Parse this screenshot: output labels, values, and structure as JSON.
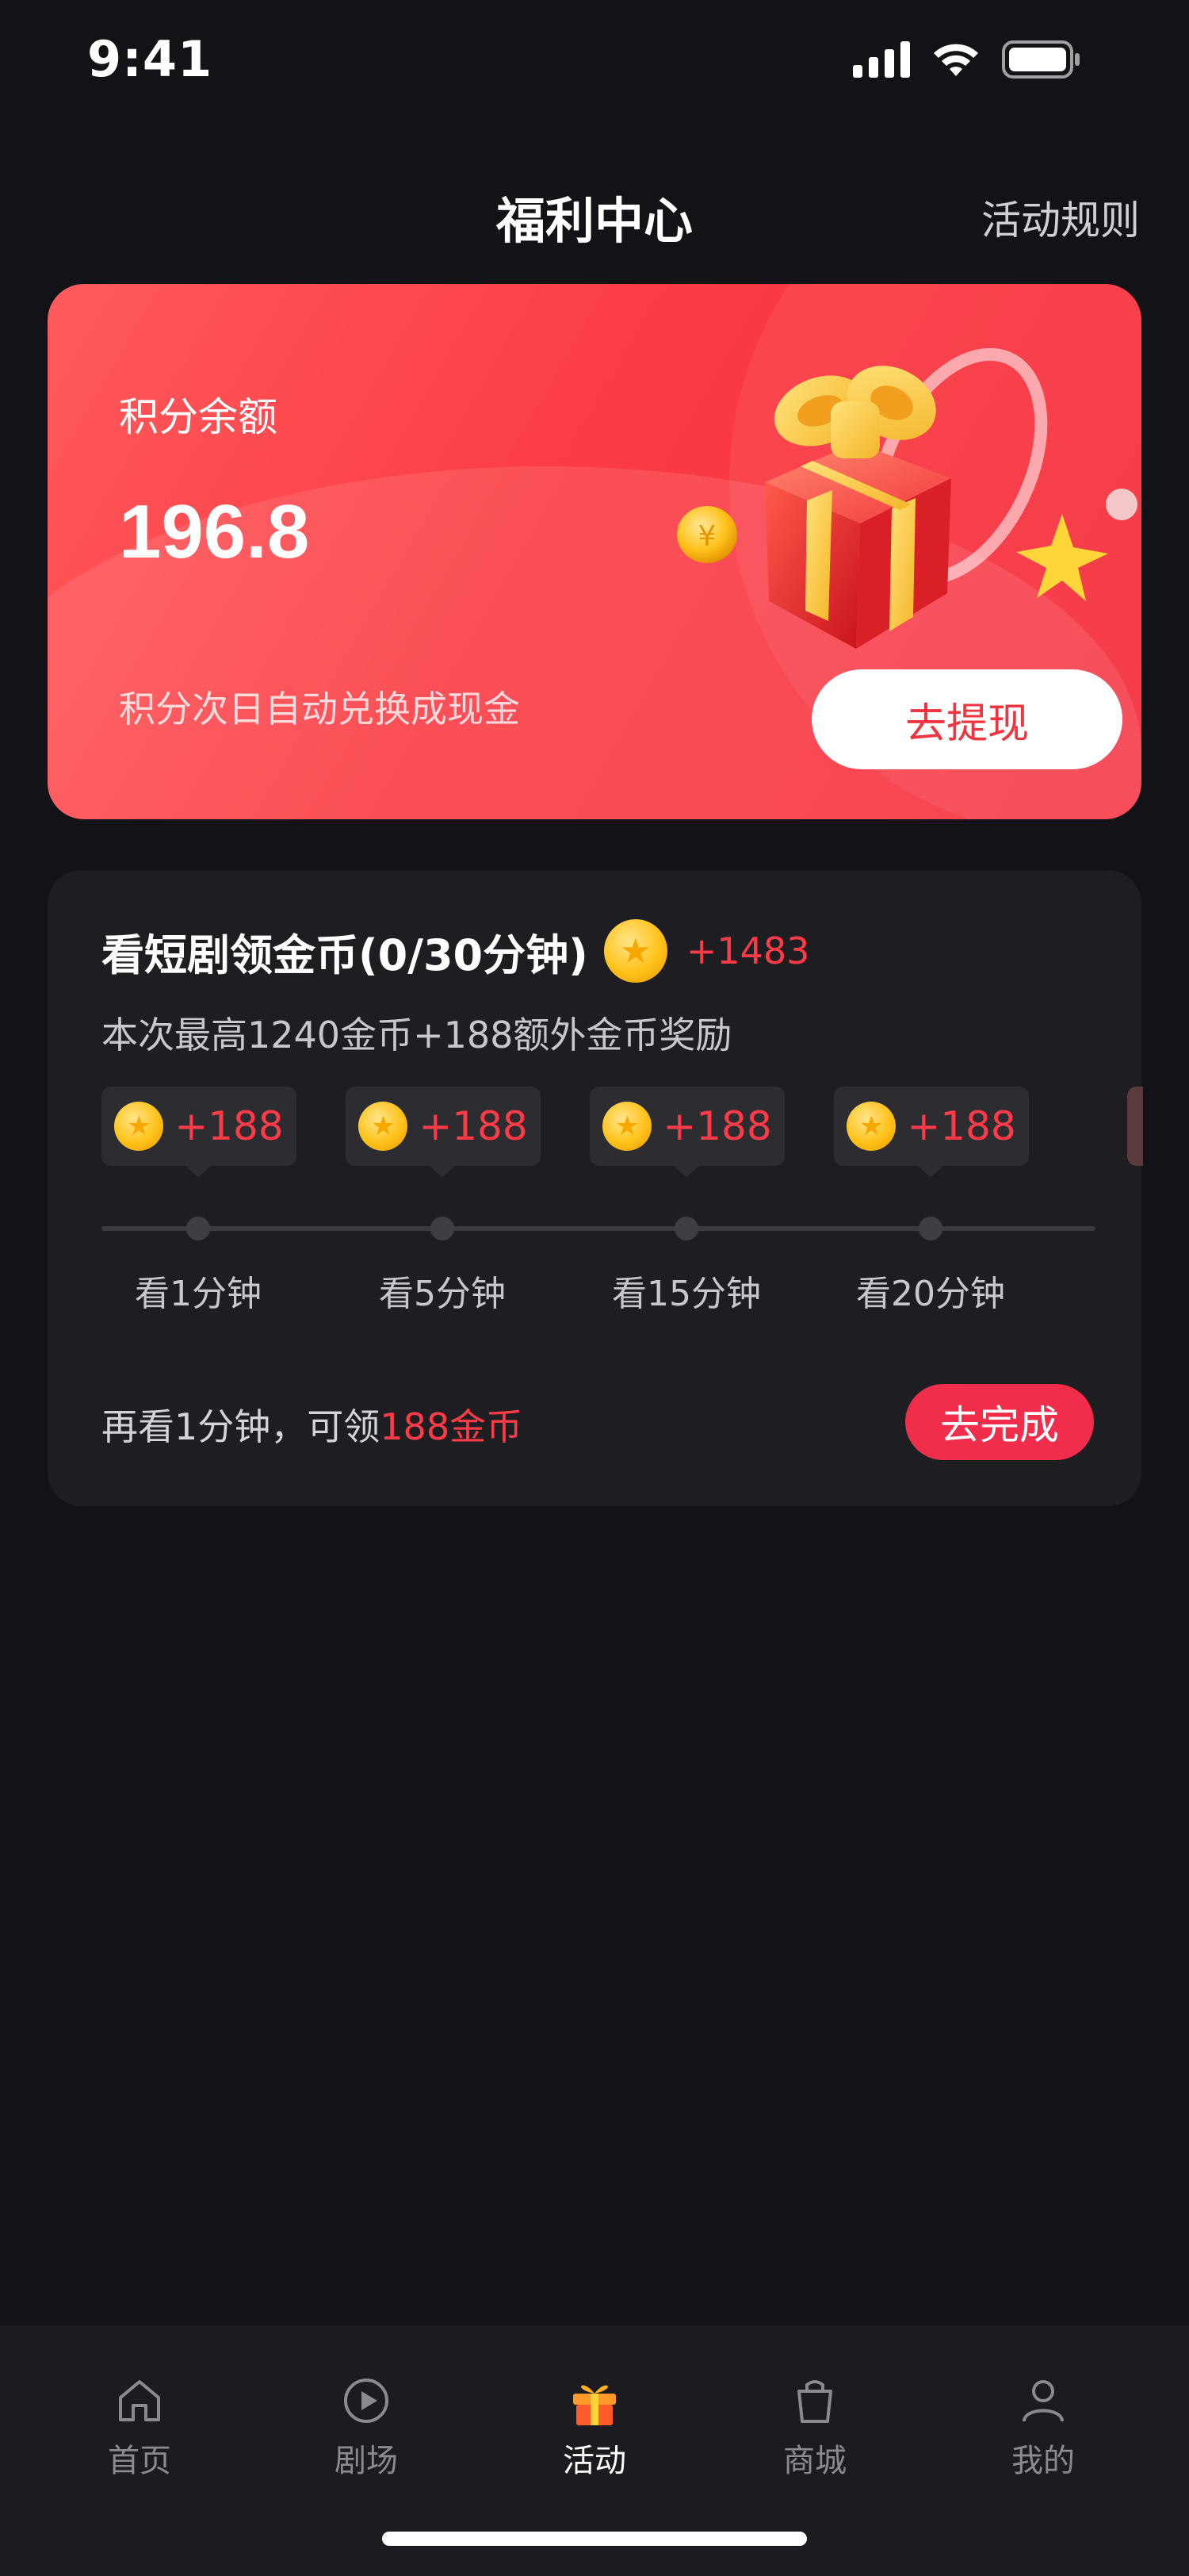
{
  "status_bar": {
    "time": "9:41"
  },
  "header": {
    "title": "福利中心",
    "rules_link": "活动规则"
  },
  "points_card": {
    "label": "积分余额",
    "value": "196.8",
    "note": "积分次日自动兑换成现金",
    "withdraw_label": "去提现"
  },
  "task": {
    "title": "看短剧领金币(0/30分钟)",
    "total_reward": "+1483",
    "subtitle": "本次最高1240金币+188额外金币奖励",
    "rewards": [
      {
        "amount": "+188",
        "milestone": "看1分钟"
      },
      {
        "amount": "+188",
        "milestone": "看5分钟"
      },
      {
        "amount": "+188",
        "milestone": "看15分钟"
      },
      {
        "amount": "+188",
        "milestone": "看20分钟"
      }
    ],
    "progress_fraction": 0,
    "hint_prefix": "再看1分钟，可领",
    "hint_highlight": "188金币",
    "complete_label": "去完成"
  },
  "tab_bar": {
    "items": [
      {
        "label": "首页",
        "icon": "home-icon",
        "active": false
      },
      {
        "label": "剧场",
        "icon": "play-icon",
        "active": false
      },
      {
        "label": "活动",
        "icon": "gift-icon",
        "active": true
      },
      {
        "label": "商城",
        "icon": "shopping-bag-icon",
        "active": false
      },
      {
        "label": "我的",
        "icon": "user-icon",
        "active": false
      }
    ]
  },
  "colors": {
    "background": "#121217",
    "accent_red": "#ff3b48",
    "card_red": "#f5303f",
    "card_dark": "#1e1e22",
    "button_red": "#f02d4a"
  }
}
